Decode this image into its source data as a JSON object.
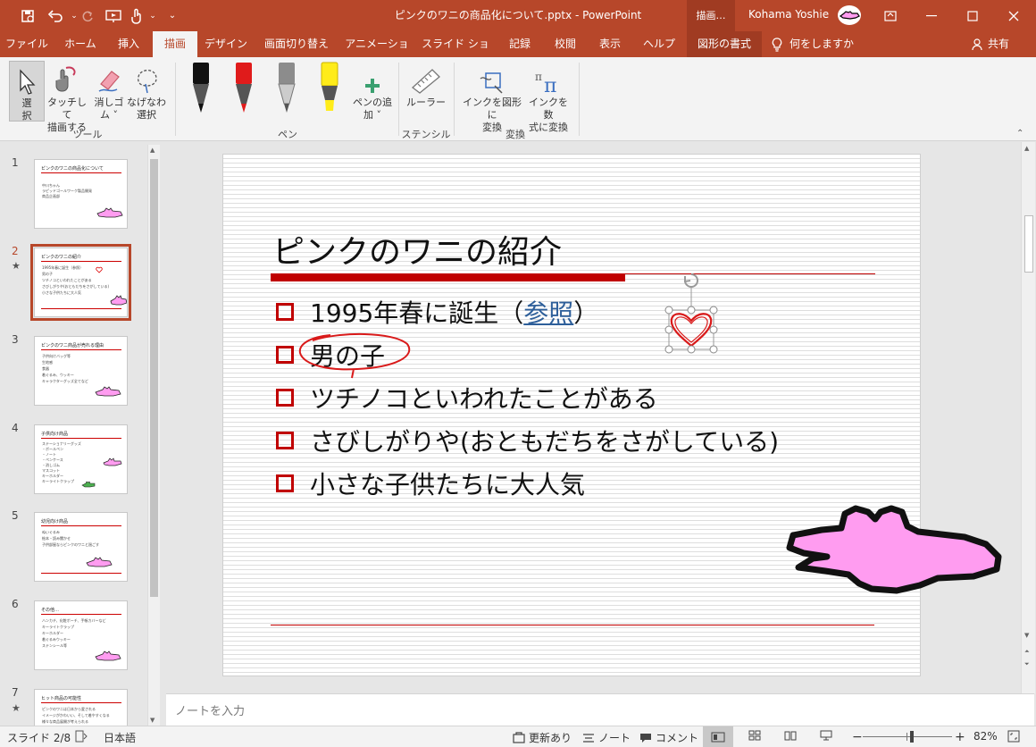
{
  "titlebar": {
    "filename": "ピンクのワニの商品化について.pptx  -  PowerPoint",
    "context_tab": "描画…",
    "user": "Kohama Yoshie"
  },
  "tabs": [
    {
      "label": "ファイル"
    },
    {
      "label": "ホーム"
    },
    {
      "label": "挿入"
    },
    {
      "label": "描画"
    },
    {
      "label": "デザイン"
    },
    {
      "label": "画面切り替え"
    },
    {
      "label": "アニメーション"
    },
    {
      "label": "スライド ショー"
    },
    {
      "label": "記録"
    },
    {
      "label": "校閲"
    },
    {
      "label": "表示"
    },
    {
      "label": "ヘルプ"
    },
    {
      "label": "図形の書式"
    }
  ],
  "search": {
    "label": "何をしますか"
  },
  "share": {
    "label": "共有"
  },
  "ribbon": {
    "select": {
      "line1": "選",
      "line2": "択"
    },
    "touch": {
      "line1": "タッチして",
      "line2": "描画する"
    },
    "eraser": {
      "line1": "消しゴ",
      "line2": "ム ˅"
    },
    "lasso": {
      "line1": "なげなわ",
      "line2": "選択"
    },
    "group_tools": "ツール",
    "add_pen": {
      "line1": "ペンの追",
      "line2": "加 ˅"
    },
    "group_pen": "ペン",
    "ruler": "ルーラー",
    "group_stencil": "ステンシル",
    "ink_shape": {
      "line1": "インクを図形に",
      "line2": "変換"
    },
    "ink_math": {
      "line1": "インクを数",
      "line2": "式に変換"
    },
    "group_convert": "変換",
    "pen_colors": [
      "#111111",
      "#e01b1b",
      "#8c8c8c",
      "#ffec1a"
    ]
  },
  "thumbnails": [
    {
      "num": "1",
      "star": "",
      "title": "ピンクのワニの商品化について",
      "lines": [
        "中川ちゃん",
        "ラピッドゴールワーク製品開発",
        "商品企画部"
      ]
    },
    {
      "num": "2",
      "star": "★",
      "title": "ピンクのワニの紹介",
      "lines": [
        "1995年春に誕生（参照）",
        "男の子",
        "ツチノコといわれたことがある",
        "さびしがりや(おともだちをさがしている)",
        "小さな子供たちに大人気"
      ]
    },
    {
      "num": "3",
      "star": "",
      "title": "ピンクのワニ商品が売れる理由",
      "lines": [
        "子供向けバッグ等",
        "生地感",
        "食器",
        "着ぐるみ、ウッキー",
        "キャラクターグッズ全てなど"
      ]
    },
    {
      "num": "4",
      "star": "",
      "title": "子供向け商品",
      "lines": [
        "ステーショナリーグッズ",
        "・ボールペン",
        "・ノート",
        "・ペンケース",
        "・消しゴム",
        "マスコット",
        "キーホルダー",
        "キーライトクラップ"
      ]
    },
    {
      "num": "5",
      "star": "",
      "title": "幼児向け商品",
      "lines": [
        "ぬいぐるみ",
        "絵本・読み聞かせ",
        "子供部屋ならピンクのワニと過ごす"
      ]
    },
    {
      "num": "6",
      "star": "",
      "title": "その他…",
      "lines": [
        "ハンカチ、化粧ポーチ、手帳カバーなど",
        "キーライトクラップ",
        "キーホルダー",
        "着ぐるみウッキー",
        "ステンシール等"
      ]
    },
    {
      "num": "7",
      "star": "★",
      "title": "ヒット商品の可能性",
      "lines": [
        "ピンクのワニは日本から愛される",
        "イメージがかわいい、そして着やすくなる",
        "様々な商品展開が考えられる"
      ]
    }
  ],
  "slide": {
    "title": "ピンクのワニの紹介",
    "b1_pre": "1995年春に誕生（",
    "b1_link": "参照",
    "b1_post": "）",
    "b2": "男の子",
    "b3": "ツチノコといわれたことがある",
    "b4": "さびしがりや(おともだちをさがしている)",
    "b5": "小さな子供たちに大人気",
    "accent": "#c00000",
    "croc_color": "#ff9cf0"
  },
  "notes": {
    "placeholder": "ノートを入力"
  },
  "status": {
    "slide": "スライド 2/8",
    "lang": "日本語",
    "updates": "更新あり",
    "notes": "ノート",
    "comments": "コメント",
    "zoom": "82%",
    "zoom_level": 0.55
  }
}
